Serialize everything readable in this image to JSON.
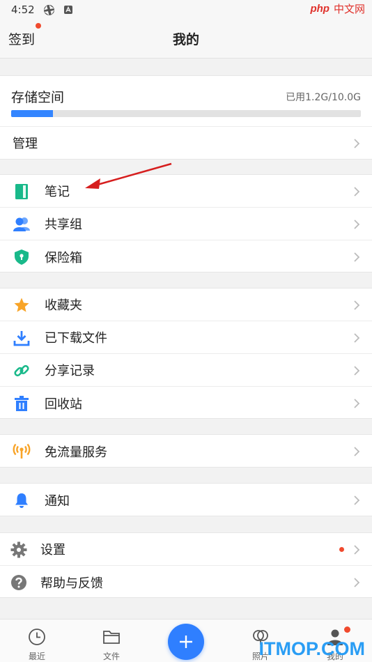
{
  "status_bar": {
    "time": "4:52"
  },
  "watermark": {
    "top_left": "php",
    "top_right": "中文网",
    "bottom": "ITMOP.COM"
  },
  "header": {
    "checkin": "签到",
    "title": "我的"
  },
  "storage": {
    "title": "存储空间",
    "used_text": "已用1.2G/10.0G",
    "used_fraction": 0.12,
    "manage_label": "管理"
  },
  "groups": [
    [
      {
        "label": "笔记",
        "icon": "note-icon"
      },
      {
        "label": "共享组",
        "icon": "group-icon"
      },
      {
        "label": "保险箱",
        "icon": "safe-box-icon"
      }
    ],
    [
      {
        "label": "收藏夹",
        "icon": "star-icon"
      },
      {
        "label": "已下载文件",
        "icon": "download-icon"
      },
      {
        "label": "分享记录",
        "icon": "link-icon"
      },
      {
        "label": "回收站",
        "icon": "trash-icon"
      }
    ],
    [
      {
        "label": "免流量服务",
        "icon": "signal-icon"
      }
    ],
    [
      {
        "label": "通知",
        "icon": "bell-icon"
      }
    ],
    [
      {
        "label": "设置",
        "icon": "gear-icon",
        "badge": true
      },
      {
        "label": "帮助与反馈",
        "icon": "help-icon"
      }
    ]
  ],
  "tabs": [
    {
      "label": "最近",
      "icon": "clock-icon"
    },
    {
      "label": "文件",
      "icon": "folder-icon"
    },
    {
      "label": "",
      "icon": "plus-icon"
    },
    {
      "label": "照片",
      "icon": "photo-icon"
    },
    {
      "label": "我的",
      "icon": "person-icon"
    }
  ],
  "colors": {
    "accent": "#2f7fff",
    "badge": "#f04a2e",
    "note": "#19b98a",
    "star": "#f8a428"
  }
}
